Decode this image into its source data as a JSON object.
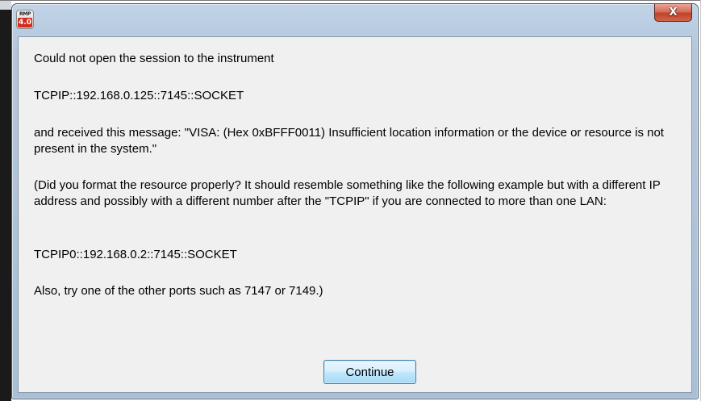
{
  "window": {
    "app_icon": {
      "top_text": "RMP",
      "bottom_text": "4.0"
    },
    "close_glyph": "X",
    "close_icon": "close-icon"
  },
  "message": {
    "line1": "Could not open the session to the instrument",
    "line2": "TCPIP::192.168.0.125::7145::SOCKET",
    "line3": "and received this message: \"VISA:  (Hex 0xBFFF0011) Insufficient location information or the device or resource is not present in the system.\"",
    "line4": "(Did you format the resource properly? It should resemble something like the following example  but with a different IP address and possibly with a different number after the \"TCPIP\" if you are connected to more than one LAN:",
    "line5": "TCPIP0::192.168.0.2::7145::SOCKET",
    "line6": "Also, try one of the other ports such as 7147 or 7149.)"
  },
  "buttons": {
    "continue_label": "Continue"
  },
  "colors": {
    "title_gradient": "#b9cde2",
    "client_bg": "#f0f0f0",
    "close_button": "#c0412a",
    "button_border": "#3c7fb1"
  }
}
